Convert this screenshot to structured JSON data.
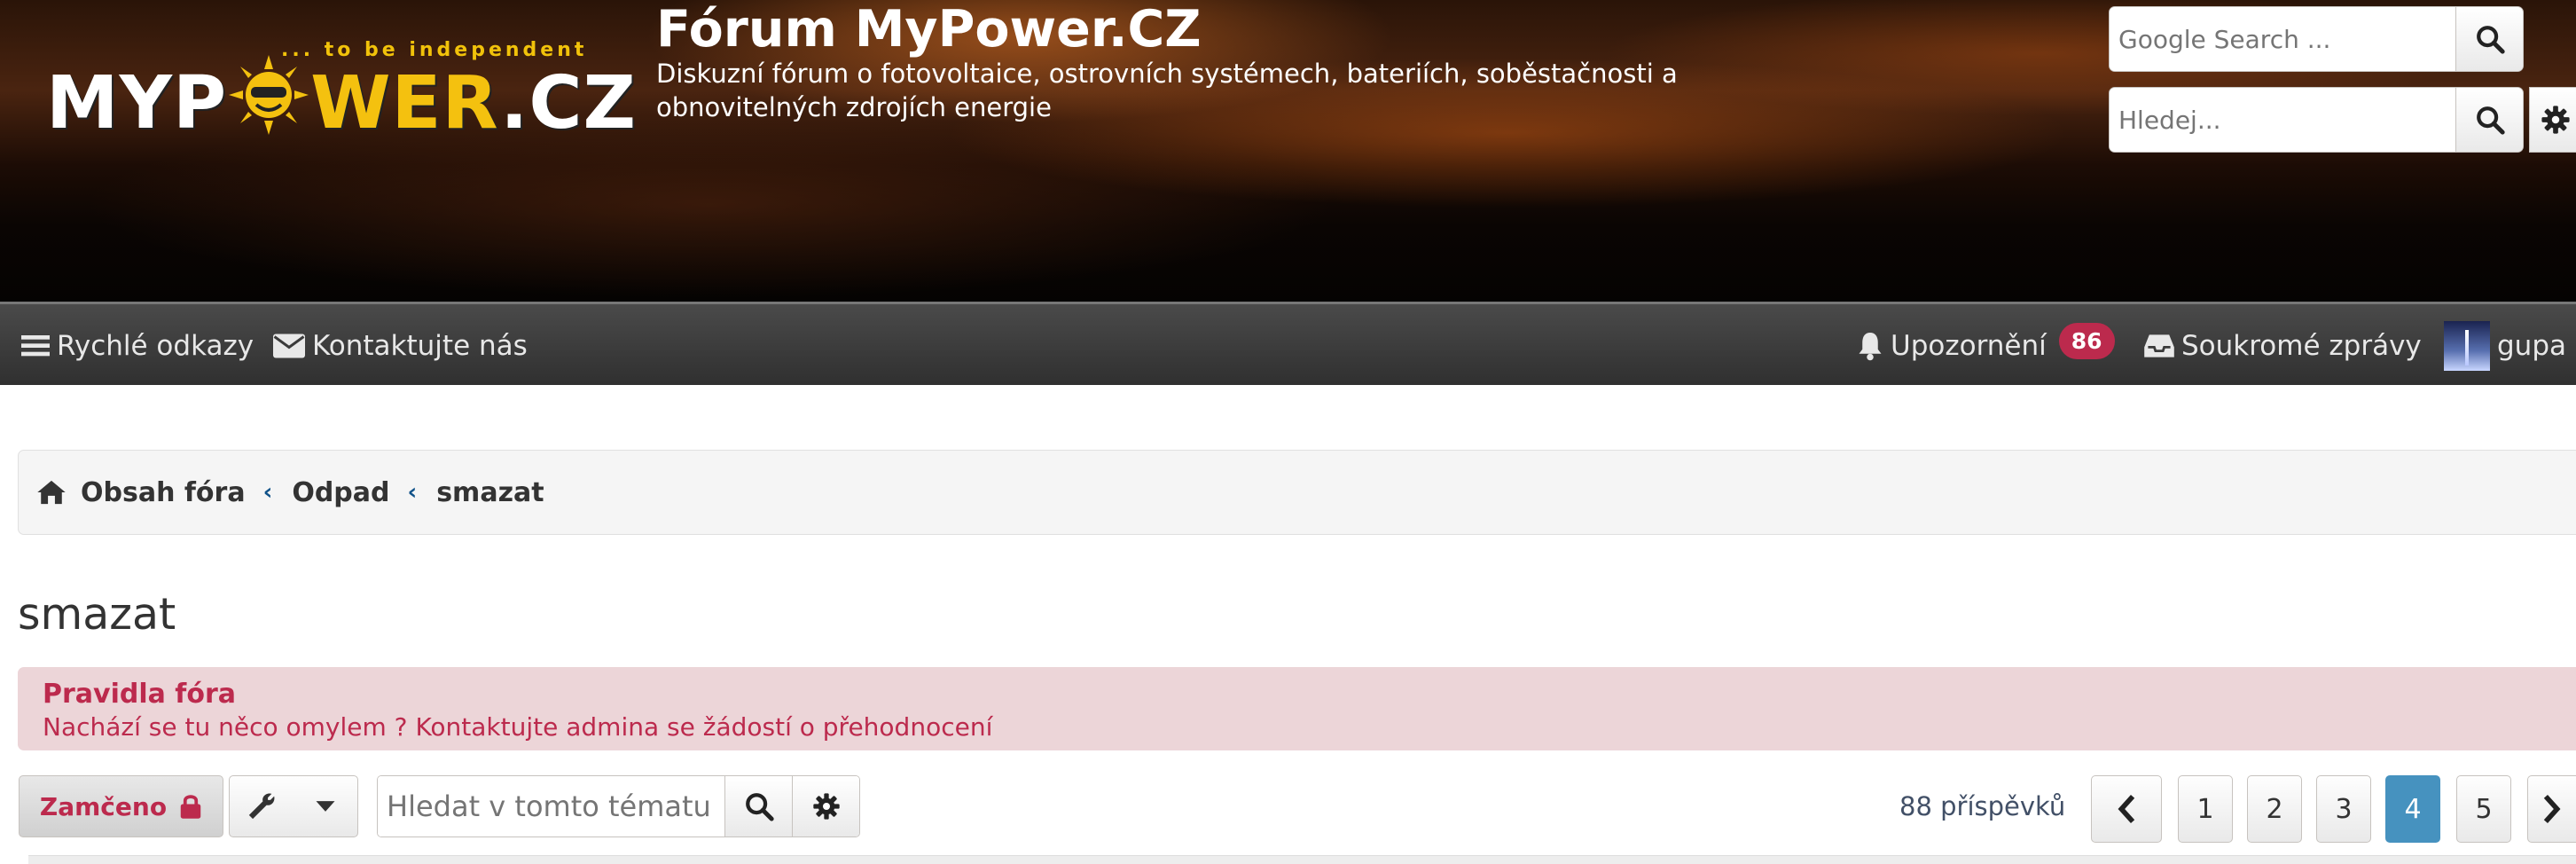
{
  "header": {
    "logo": {
      "tagline": "... to be independent",
      "text_a": "MYP",
      "text_b": "WER",
      "text_c": ".CZ"
    },
    "site_title": "Fórum MyPower.CZ",
    "site_description": "Diskuzní fórum o fotovoltaice, ostrovních systémech, bateriích, soběstačnosti a obnovitelných zdrojích energie",
    "google_search_placeholder": "Google Search ...",
    "site_search_placeholder": "Hledej..."
  },
  "navbar": {
    "quick_links": "Rychlé odkazy",
    "contact": "Kontaktujte nás",
    "notifications": "Upozornění",
    "notifications_count": "86",
    "private_messages": "Soukromé zprávy",
    "username": "gupa"
  },
  "breadcrumbs": [
    "Obsah fóra",
    "Odpad",
    "smazat"
  ],
  "topic": {
    "title": "smazat",
    "rules_title": "Pravidla fóra",
    "rules_text": "Nachází se tu něco omylem ? Kontaktujte admina se žádostí o přehodnocení"
  },
  "actions": {
    "locked_label": "Zamčeno",
    "topic_search_placeholder": "Hledat v tomto tématu",
    "post_count": "88 příspěvků",
    "pages": [
      "1",
      "2",
      "3",
      "4",
      "5"
    ],
    "current_page": "4"
  },
  "colors": {
    "accent_red": "#bc2a4d",
    "link_blue": "#105289",
    "active_page": "#4692bf",
    "logo_yellow": "#f4c10f"
  },
  "icons": [
    "search-icon",
    "gear-icon",
    "menu-icon",
    "envelope-icon",
    "bell-icon",
    "inbox-icon",
    "home-icon",
    "chevron-left-icon",
    "lock-icon",
    "wrench-icon",
    "caret-down-icon",
    "chevron-right-icon"
  ]
}
